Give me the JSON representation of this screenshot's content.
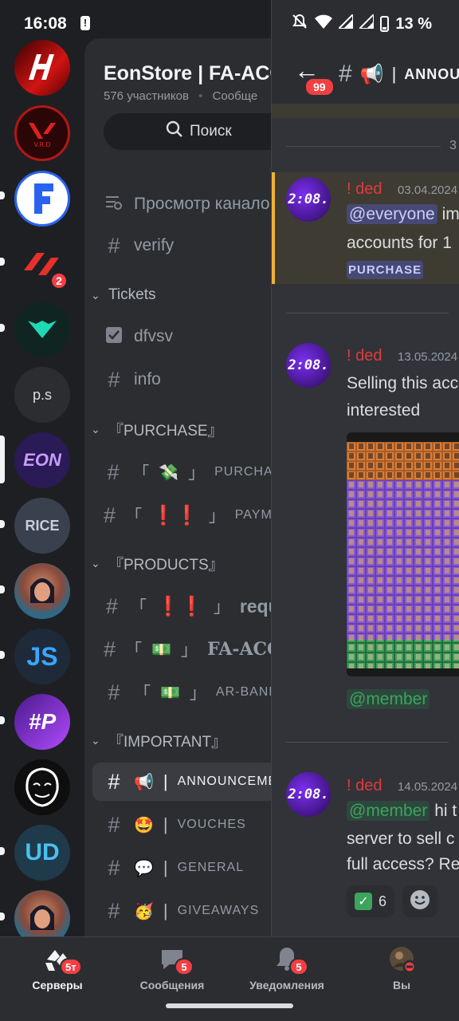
{
  "status_bar": {
    "time": "16:08",
    "battery": "13 %"
  },
  "server_rail": {
    "servers": [
      {
        "name": "server-h",
        "badge": ""
      },
      {
        "name": "server-vrd",
        "badge": ""
      },
      {
        "name": "server-f",
        "badge": ""
      },
      {
        "name": "server-red",
        "badge": "2"
      },
      {
        "name": "server-mask",
        "badge": ""
      },
      {
        "name": "server-ps",
        "label": "p.s",
        "badge": ""
      },
      {
        "name": "server-eon",
        "label": "EON",
        "badge": ""
      },
      {
        "name": "server-rice",
        "label": "RICE",
        "badge": ""
      },
      {
        "name": "server-girl",
        "badge": ""
      },
      {
        "name": "server-js",
        "label": "JS",
        "badge": ""
      },
      {
        "name": "server-p",
        "label": "#P",
        "badge": ""
      },
      {
        "name": "server-anon",
        "badge": ""
      },
      {
        "name": "server-ud",
        "label": "UD",
        "badge": ""
      },
      {
        "name": "server-girl2",
        "badge": ""
      }
    ]
  },
  "channels_panel": {
    "server_name": "EonStore | FA-ACC",
    "members": "576 участников",
    "members_extra": "Сообще",
    "search_label": "Поиск",
    "browse_label": "Просмотр канало",
    "verify_label": "verify",
    "cat_tickets": "Tickets",
    "dfvsv_label": "dfvsv",
    "info_label": "info",
    "cat_purchase": "『PURCHASE』",
    "purchase_ch": "PURCHASE",
    "payment_ch": "PAYMEN",
    "cat_products": "『PRODUCTS』",
    "requir_ch": "requir",
    "fa_acc_ch": "FA-ACCO",
    "ar_banks_ch": "AR-BANKS",
    "cat_important": "『IMPORTANT』",
    "announce_ch": "ANNOUNCEMEN",
    "vouches_ch": "VOUCHES",
    "general_ch": "GENERAL",
    "giveaways_ch": "GIVEAWAYS"
  },
  "chat": {
    "unread_badge": "99",
    "title": "ANNOU",
    "date_fragment": "3",
    "messages": [
      {
        "author": "! ded",
        "date": "03.04.2024",
        "avatar_text": "2:08.",
        "line1_mention": "@everyone",
        "line1_rest": "im",
        "line2": "accounts for 1",
        "role_tag": "PURCHASE"
      },
      {
        "author": "! ded",
        "date": "13.05.2024",
        "avatar_text": "2:08.",
        "line1": "Selling this acc",
        "line2": "interested",
        "mention": "@member"
      },
      {
        "author": "! ded",
        "date": "14.05.2024",
        "avatar_text": "2:08.",
        "line1_mention": "@member",
        "line1_rest": "hi t",
        "line2": "server to sell c",
        "line3": "full access? Re",
        "reaction_count": "6"
      }
    ]
  },
  "bottom_nav": {
    "servers_label": "Серверы",
    "servers_badge": "5т",
    "messages_label": "Сообщения",
    "messages_badge": "5",
    "notifications_label": "Уведомления",
    "notifications_badge": "5",
    "you_label": "Вы"
  }
}
